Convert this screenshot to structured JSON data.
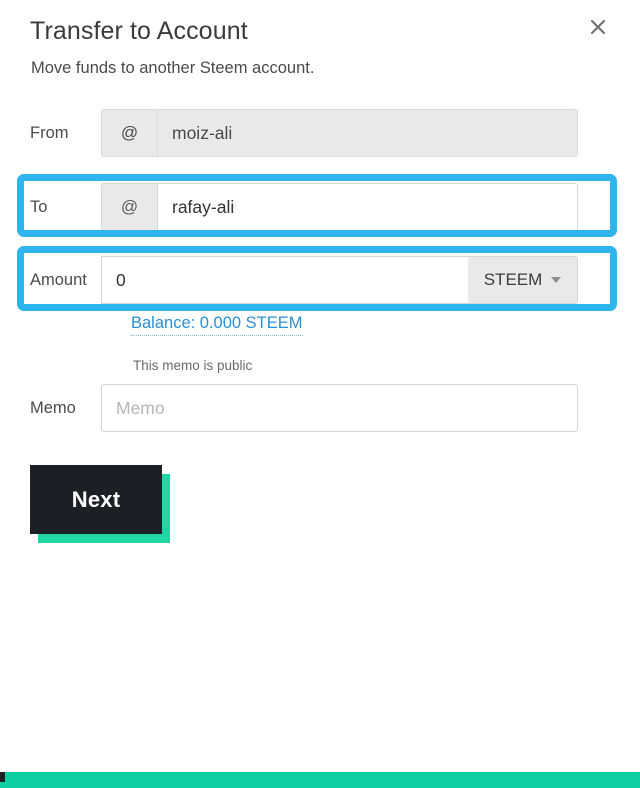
{
  "header": {
    "title": "Transfer to Account",
    "subtitle": "Move funds to another Steem account.",
    "close_icon": "close-icon"
  },
  "form": {
    "from": {
      "label": "From",
      "prefix": "@",
      "value": "moiz-ali",
      "disabled": true
    },
    "to": {
      "label": "To",
      "prefix": "@",
      "value": "rafay-ali",
      "placeholder": "",
      "highlighted": true
    },
    "amount": {
      "label": "Amount",
      "value": "0",
      "placeholder": "",
      "currency": "STEEM",
      "currency_caret_icon": "chevron-down-icon",
      "highlighted": true
    },
    "balance": {
      "text": "Balance: 0.000 STEEM"
    },
    "memo": {
      "label": "Memo",
      "hint": "This memo is public",
      "value": "",
      "placeholder": "Memo"
    }
  },
  "actions": {
    "next_label": "Next"
  },
  "colors": {
    "highlight": "#2fb5ee",
    "accent_teal": "#0ecfa4",
    "button_dark": "#1b2026",
    "link_blue": "#2a8fd4"
  }
}
